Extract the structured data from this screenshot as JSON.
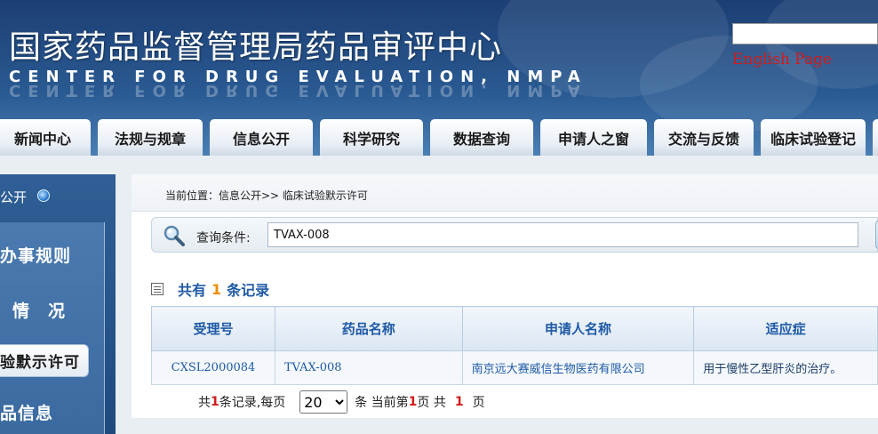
{
  "header": {
    "title_cn": "国家药品监督管理局药品审评中心",
    "title_en": "CENTER FOR DRUG EVALUATION, NMPA",
    "english_link": "English Page",
    "search_value": ""
  },
  "nav": {
    "tabs": [
      {
        "label": "新闻中心"
      },
      {
        "label": "法规与规章"
      },
      {
        "label": "信息公开"
      },
      {
        "label": "科学研究"
      },
      {
        "label": "数据查询"
      },
      {
        "label": "申请人之窗"
      },
      {
        "label": "交流与反馈"
      },
      {
        "label": "临床试验登记"
      }
    ]
  },
  "sidebar": {
    "heading": "公开",
    "items": [
      {
        "label": "办事规则"
      },
      {
        "label": "情　况"
      },
      {
        "label": "验默示许可"
      },
      {
        "label": "品信息"
      }
    ]
  },
  "breadcrumb": "当前位置：信息公开>> 临床试验默示许可",
  "query": {
    "label": "查询条件:",
    "value": "TVAX-008"
  },
  "results": {
    "prefix": "共有",
    "count": "1",
    "suffix": "条记录",
    "columns": [
      "受理号",
      "药品名称",
      "申请人名称",
      "适应症"
    ],
    "rows": [
      {
        "id": "CXSL2000084",
        "drug": "TVAX-008",
        "applicant": "南京远大赛威信生物医药有限公司",
        "indication": "用于慢性乙型肝炎的治疗。"
      }
    ]
  },
  "pager": {
    "t1": "共",
    "total": "1",
    "t2": "条记录,每页",
    "per_page": "20",
    "t3": "条 当前第",
    "current": "1",
    "t4": "页 共",
    "pages": "1",
    "t5": "页"
  },
  "colors": {
    "header_bg": "#1c3f74",
    "link_red": "#d41a1a",
    "accent_blue": "#1f5aa6",
    "count_orange": "#f08c00"
  }
}
